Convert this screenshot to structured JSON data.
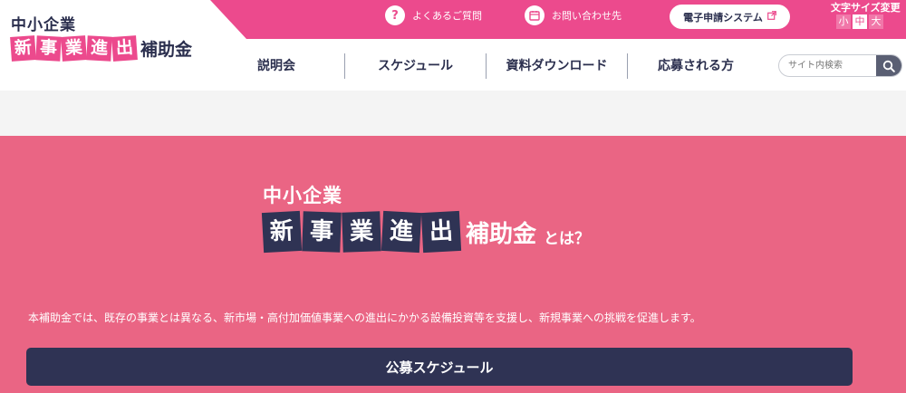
{
  "logo": {
    "small": "中小企業",
    "tiles": [
      "新",
      "事",
      "業",
      "進",
      "出"
    ],
    "tail": "補助金"
  },
  "top_links": {
    "faq_icon": "question-icon",
    "faq_label": "よくあるご質問",
    "contact_icon": "calendar-contact-icon",
    "contact_label": "お問い合わせ先",
    "system_label": "電子申請システム",
    "system_icon": "external-link-icon"
  },
  "font_size": {
    "label": "文字サイズ変更",
    "small": "小",
    "medium": "中",
    "large": "大",
    "selected": "中"
  },
  "nav": {
    "items": [
      "説明会",
      "スケジュール",
      "資料ダウンロード",
      "応募される方"
    ]
  },
  "search": {
    "placeholder": "サイト内検索",
    "icon": "search-icon"
  },
  "hero": {
    "small": "中小企業",
    "tiles": [
      "新",
      "事",
      "業",
      "進",
      "出"
    ],
    "tail": "補助金",
    "suffix": "とは？",
    "description": "本補助金では、既存の事業とは異なる、新市場・高付加価値事業への進出にかかる設備投資等を支援し、新規事業への挑戦を促進します。",
    "button_label": "公募スケジュール"
  },
  "colors": {
    "brand_pink": "#ec4a8d",
    "hero_pink": "#ea6584",
    "navy": "#2f3354"
  }
}
